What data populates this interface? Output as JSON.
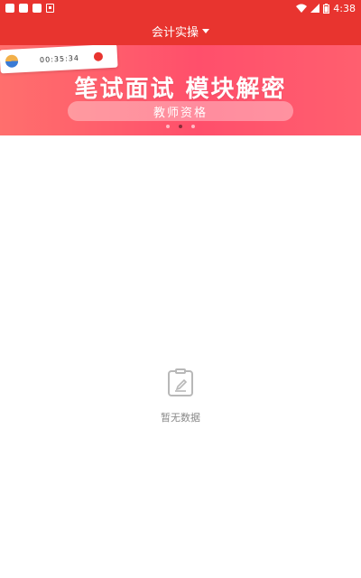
{
  "status_bar": {
    "time": "4:38"
  },
  "header": {
    "title": "会计实操"
  },
  "banner": {
    "card_timer": "00:35:34",
    "headline": "笔试面试 模块解密",
    "pill_text": "教师资格",
    "carousel": {
      "count": 3,
      "active_index": 1
    }
  },
  "empty_state": {
    "text": "暂无数据",
    "icon": "notepad-pen-icon"
  },
  "colors": {
    "primary": "#e8342f",
    "banner_accent": "#ff4f6b",
    "muted_text": "#888888"
  }
}
